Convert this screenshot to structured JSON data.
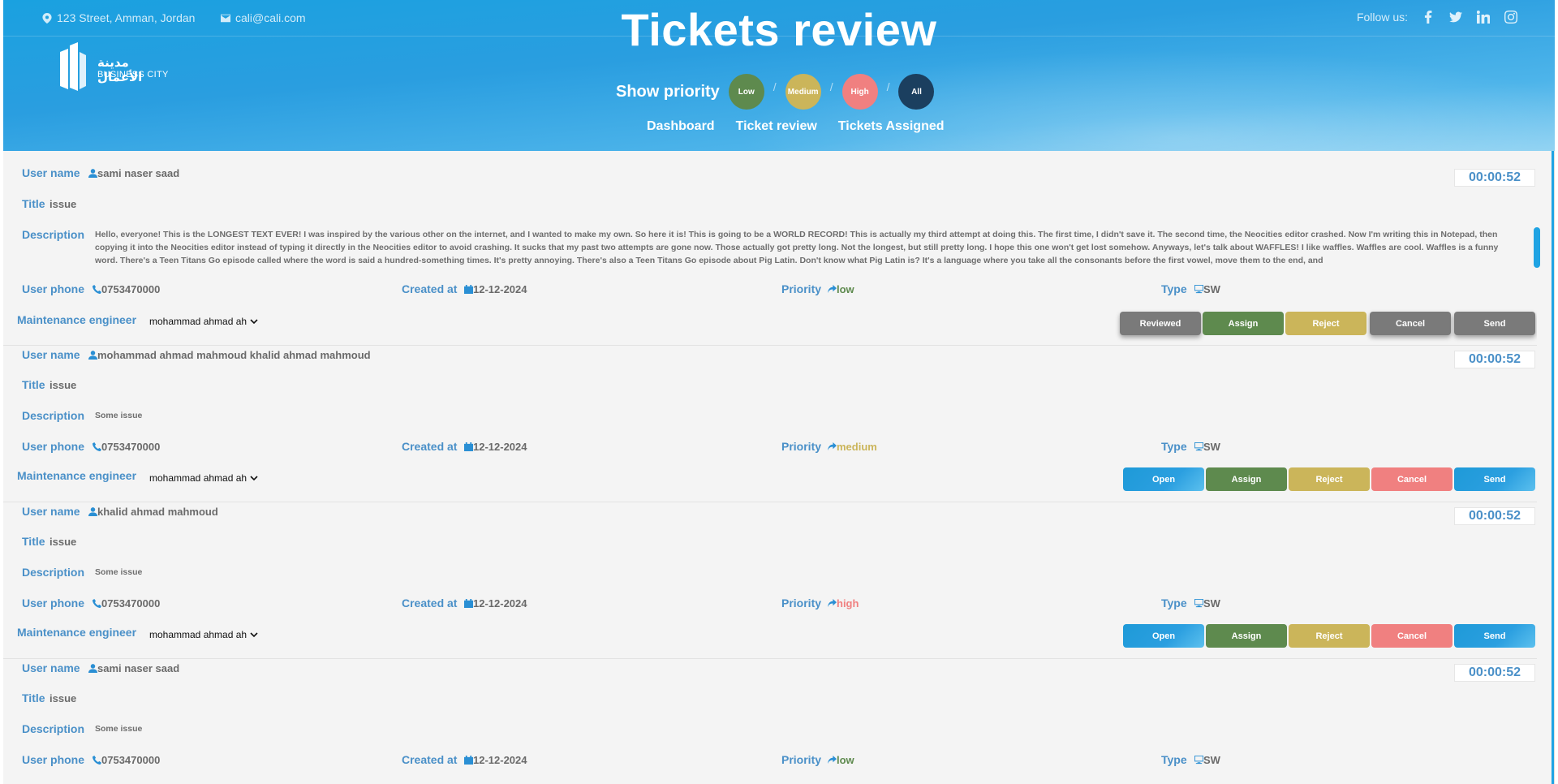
{
  "header": {
    "address": "123 Street, Amman, Jordan",
    "email": "cali@cali.com",
    "follow_label": "Follow us:",
    "social": [
      "facebook-icon",
      "twitter-icon",
      "linkedin-icon",
      "instagram-icon"
    ],
    "logo_ar": "مدينة الأعمال",
    "logo_en": "BUSINESS CITY",
    "title": "Tickets review",
    "show_priority_label": "Show priority",
    "priorities": [
      {
        "label": "Low",
        "color": "#5e8a4e"
      },
      {
        "label": "Medium",
        "color": "#cbb55a"
      },
      {
        "label": "High",
        "color": "#f08080"
      },
      {
        "label": "All",
        "color": "#1b3f5f"
      }
    ],
    "nav": [
      "Dashboard",
      "Ticket review",
      "Tickets Assigned"
    ]
  },
  "labels": {
    "user_name": "User name",
    "title": "Title",
    "description": "Description",
    "user_phone": "User phone",
    "created_at": "Created at",
    "priority": "Priority",
    "type": "Type",
    "engineer": "Maintenance engineer"
  },
  "tickets": [
    {
      "user": "sami naser saad",
      "title": "issue",
      "description": "Hello, everyone! This is the LONGEST TEXT EVER! I was inspired by the various other on the internet, and I wanted to make my own. So here it is! This is going to be a WORLD RECORD! This is actually my third attempt at doing this. The first time, I didn't save it. The second time, the Neocities editor crashed. Now I'm writing this in Notepad, then copying it into the Neocities editor instead of typing it directly in the Neocities editor to avoid crashing. It sucks that my past two attempts are gone now. Those actually got pretty long. Not the longest, but still pretty long. I hope this one won't get lost somehow. Anyways, let's talk about WAFFLES! I like waffles. Waffles are cool. Waffles is a funny word. There's a Teen Titans Go episode called where the word is said a hundred-something times. It's pretty annoying. There's also a Teen Titans Go episode about Pig Latin. Don't know what Pig Latin is? It's a language where you take all the consonants before the first vowel, move them to the end, and",
      "phone": "0753470000",
      "created": "12-12-2024",
      "priority": "low",
      "priority_color": "#5e8a4e",
      "type": "SW",
      "engineer": "mohammad ahmad ah",
      "timer": "00:00:52",
      "buttons": [
        "Reviewed",
        "Assign",
        "Reject",
        "Cancel",
        "Send"
      ]
    },
    {
      "user": "mohammad ahmad mahmoud khalid ahmad mahmoud",
      "title": "issue",
      "description": "Some issue",
      "phone": "0753470000",
      "created": "12-12-2024",
      "priority": "medium",
      "priority_color": "#cbb55a",
      "type": "SW",
      "engineer": "mohammad ahmad ah",
      "timer": "00:00:52",
      "buttons": [
        "Open",
        "Assign",
        "Reject",
        "Cancel",
        "Send"
      ]
    },
    {
      "user": "khalid ahmad mahmoud",
      "title": "issue",
      "description": "Some issue",
      "phone": "0753470000",
      "created": "12-12-2024",
      "priority": "high",
      "priority_color": "#f08080",
      "type": "SW",
      "engineer": "mohammad ahmad ah",
      "timer": "00:00:52",
      "buttons": [
        "Open",
        "Assign",
        "Reject",
        "Cancel",
        "Send"
      ]
    },
    {
      "user": "sami naser saad",
      "title": "issue",
      "description": "Some issue",
      "phone": "0753470000",
      "created": "12-12-2024",
      "priority": "low",
      "priority_color": "#5e8a4e",
      "type": "SW",
      "timer": "00:00:52"
    }
  ]
}
